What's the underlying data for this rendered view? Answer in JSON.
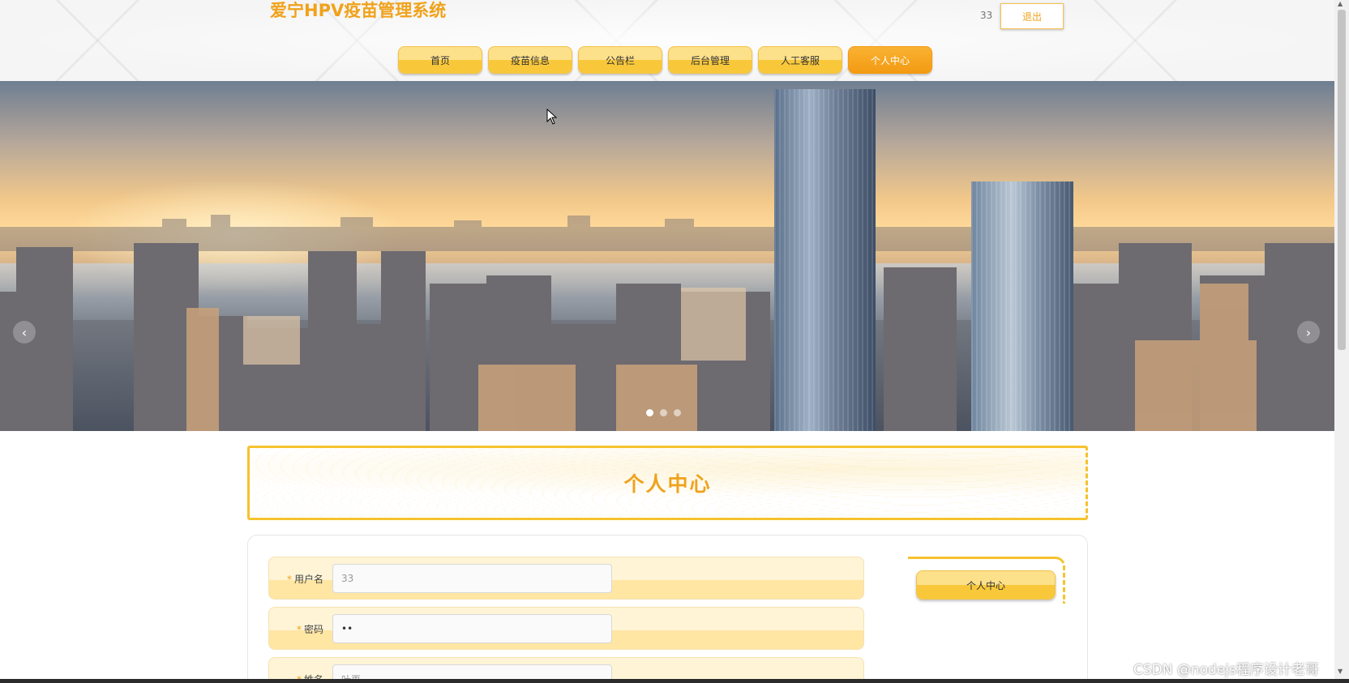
{
  "header": {
    "site_title": "爱宁HPV疫苗管理系统",
    "user_name": "33",
    "logout_label": "退出",
    "nav": [
      {
        "label": "首页",
        "active": false
      },
      {
        "label": "疫苗信息",
        "active": false
      },
      {
        "label": "公告栏",
        "active": false
      },
      {
        "label": "后台管理",
        "active": false
      },
      {
        "label": "人工客服",
        "active": false
      },
      {
        "label": "个人中心",
        "active": true
      }
    ]
  },
  "banner": {
    "prev_arrow": "‹",
    "next_arrow": "›",
    "slides": 3,
    "active_slide": 1
  },
  "page": {
    "title": "个人中心"
  },
  "form": {
    "fields": [
      {
        "label": "用户名",
        "value": "33",
        "required": true
      },
      {
        "label": "密码",
        "value": "••",
        "required": true
      },
      {
        "label": "姓名",
        "value": "叶再",
        "required": true
      }
    ]
  },
  "side_menu": {
    "items": [
      {
        "label": "个人中心"
      }
    ]
  },
  "watermark": "CSDN @nodejs程序设计老哥",
  "colors": {
    "accent": "#f0a21b",
    "button_light": "#fde08a",
    "button_dark": "#f9c83a"
  }
}
